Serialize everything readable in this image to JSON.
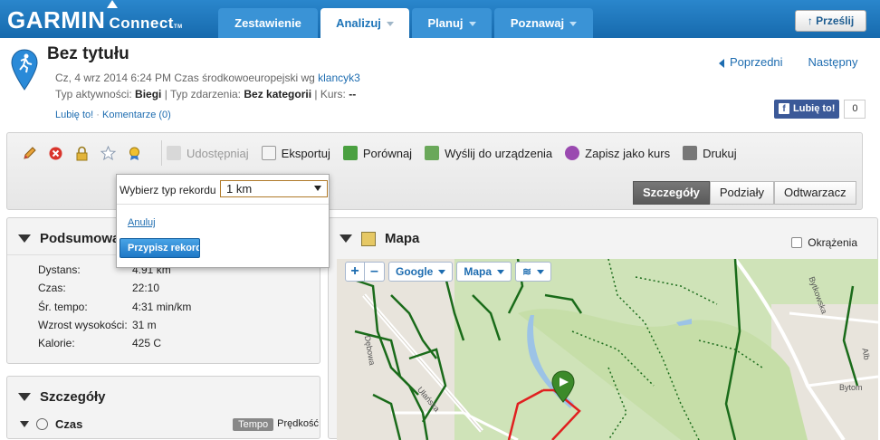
{
  "brand": {
    "name": "GARMIN",
    "product": "Connect",
    "tm": "TM"
  },
  "nav": {
    "tabs": [
      {
        "label": "Zestawienie",
        "active": false,
        "has_menu": false
      },
      {
        "label": "Analizuj",
        "active": true,
        "has_menu": true
      },
      {
        "label": "Planuj",
        "active": false,
        "has_menu": true
      },
      {
        "label": "Poznawaj",
        "active": false,
        "has_menu": true
      }
    ],
    "upload_label": "Prześlij"
  },
  "activity": {
    "title": "Bez tytułu",
    "datetime": "Cz, 4 wrz 2014 6:24 PM Czas środkowoeuropejski wg",
    "user": "klancyk3",
    "type_label": "Typ aktywności:",
    "type_value": "Biegi",
    "event_label": "| Typ zdarzenia:",
    "event_value": "Bez kategorii",
    "course_label": "| Kurs:",
    "course_value": "--",
    "like_link": "Lubię to!",
    "comments_link": "Komentarze (0)",
    "separator": "·"
  },
  "pager": {
    "prev": "Poprzedni",
    "next": "Następny"
  },
  "facebook": {
    "label": "Lubię to!",
    "count": "0"
  },
  "toolbar": {
    "actions": [
      {
        "label": "Udostępniaj",
        "disabled": true,
        "icon": "share-icon"
      },
      {
        "label": "Eksportuj",
        "disabled": false,
        "icon": "export-icon"
      },
      {
        "label": "Porównaj",
        "disabled": false,
        "icon": "compare-icon"
      },
      {
        "label": "Wyślij do urządzenia",
        "disabled": false,
        "icon": "send-to-device-icon"
      },
      {
        "label": "Zapisz jako kurs",
        "disabled": false,
        "icon": "save-course-icon"
      },
      {
        "label": "Drukuj",
        "disabled": false,
        "icon": "print-icon"
      }
    ],
    "views": [
      {
        "label": "Szczegóły",
        "active": true
      },
      {
        "label": "Podziały",
        "active": false
      },
      {
        "label": "Odtwarzacz",
        "active": false
      }
    ],
    "icon_names": [
      "edit-icon",
      "delete-icon",
      "lock-icon",
      "star-icon",
      "record-icon"
    ]
  },
  "record_popup": {
    "label": "Wybierz typ rekordu",
    "selected": "1 km",
    "cancel": "Anuluj",
    "assign": "Przypisz rekord"
  },
  "summary": {
    "title": "Podsumowanie",
    "rows": [
      {
        "key": "Dystans:",
        "value": "4.91 km"
      },
      {
        "key": "Czas:",
        "value": "22:10"
      },
      {
        "key": "Śr. tempo:",
        "value": "4:31 min/km"
      },
      {
        "key": "Wzrost wysokości:",
        "value": "31 m"
      },
      {
        "key": "Kalorie:",
        "value": "425 C"
      }
    ]
  },
  "details": {
    "title": "Szczegóły",
    "time_section": "Czas",
    "toggle_on": "Tempo",
    "toggle_off": "Prędkość"
  },
  "map": {
    "title": "Mapa",
    "laps_label": "Okrążenia",
    "controls": {
      "zoom_in": "+",
      "zoom_out": "–",
      "provider": "Google",
      "type": "Mapa"
    },
    "streets": [
      "Dębowa",
      "Ułańska",
      "Bytkowska",
      "Alb",
      "Bytom"
    ]
  },
  "colors": {
    "brand_blue": "#1d74b8",
    "route_red": "#e02020",
    "trail_green": "#1a6b1a",
    "start_marker": "#3c8a2a"
  }
}
